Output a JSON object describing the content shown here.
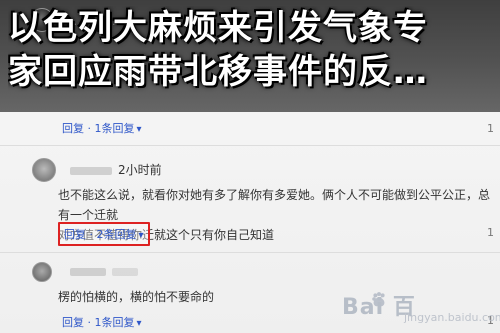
{
  "headline": {
    "line1": "以色列大麻烦来引发气象专",
    "line2": "家回应雨带北移事件的反…"
  },
  "comments": [
    {
      "reply_label": "回复 · 1条回复",
      "count": "1"
    },
    {
      "time": "2小时前",
      "body": "也不能这么说，就看你对她有多了解你有多爱她。俩个人不可能做到公平公正，总有一个迁就\n对方值不值得你迁就这个只有你自己知道",
      "reply_label": "回复 · 2条回复",
      "count": "1"
    },
    {
      "body": "楞的怕横的，横的怕不要命的",
      "reply_label": "回复 · 1条回复",
      "count": "1"
    }
  ],
  "watermark": {
    "text": "Bai 百",
    "subtext": "jingyan.baidu.com"
  },
  "icons": {
    "caret": "chevron-down-icon",
    "watermark": "baidu-paw-icon"
  },
  "colors": {
    "link": "#2f57c9",
    "highlight_box": "#d22222"
  }
}
